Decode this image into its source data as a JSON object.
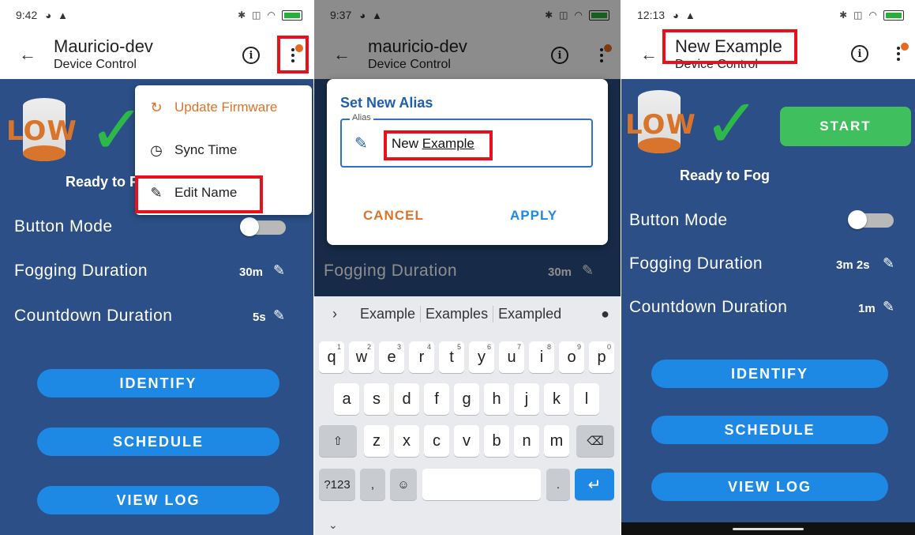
{
  "screens": [
    {
      "status_time": "9:42",
      "battery": "100",
      "title": "Mauricio-dev",
      "subtitle": "Device Control",
      "level": "LOW",
      "ready_text": "Ready to Fog",
      "button_mode_label": "Button Mode",
      "fogging_label": "Fogging Duration",
      "fogging_value": "30m",
      "countdown_label": "Countdown Duration",
      "countdown_value": "5s",
      "identify": "IDENTIFY",
      "schedule": "SCHEDULE",
      "view_log": "VIEW LOG",
      "menu": {
        "update_firmware": "Update Firmware",
        "sync_time": "Sync Time",
        "edit_name": "Edit Name"
      }
    },
    {
      "status_time": "9:37",
      "battery": "100",
      "title": "mauricio-dev",
      "subtitle": "Device Control",
      "fogging_label": "Fogging Duration",
      "fogging_value": "30m",
      "dialog": {
        "title": "Set New Alias",
        "field_label": "Alias",
        "value_plain": "New ",
        "value_underlined": "Example",
        "cancel": "CANCEL",
        "apply": "APPLY"
      },
      "keyboard": {
        "suggestions": [
          "Example",
          "Examples",
          "Exampled"
        ],
        "row1": [
          "q",
          "w",
          "e",
          "r",
          "t",
          "y",
          "u",
          "i",
          "o",
          "p"
        ],
        "row1_hints": [
          "1",
          "2",
          "3",
          "4",
          "5",
          "6",
          "7",
          "8",
          "9",
          "0"
        ],
        "row2": [
          "a",
          "s",
          "d",
          "f",
          "g",
          "h",
          "j",
          "k",
          "l"
        ],
        "row3": [
          "z",
          "x",
          "c",
          "v",
          "b",
          "n",
          "m"
        ],
        "symbols_key": "?123",
        "comma": ",",
        "period": "."
      }
    },
    {
      "status_time": "12:13",
      "battery": "100",
      "title": "New Example",
      "subtitle": "Device Control",
      "level": "LOW",
      "start": "START",
      "ready_text": "Ready to Fog",
      "button_mode_label": "Button Mode",
      "fogging_label": "Fogging Duration",
      "fogging_value": "3m 2s",
      "countdown_label": "Countdown Duration",
      "countdown_value": "1m",
      "identify": "IDENTIFY",
      "schedule": "SCHEDULE",
      "view_log": "VIEW LOG"
    }
  ],
  "colors": {
    "panel": "#2b4f86",
    "pill": "#1e88e5",
    "accent_orange": "#d8742c",
    "check_green": "#2db84a",
    "start_green": "#3fbf5d",
    "highlight_red": "#e8101a"
  }
}
